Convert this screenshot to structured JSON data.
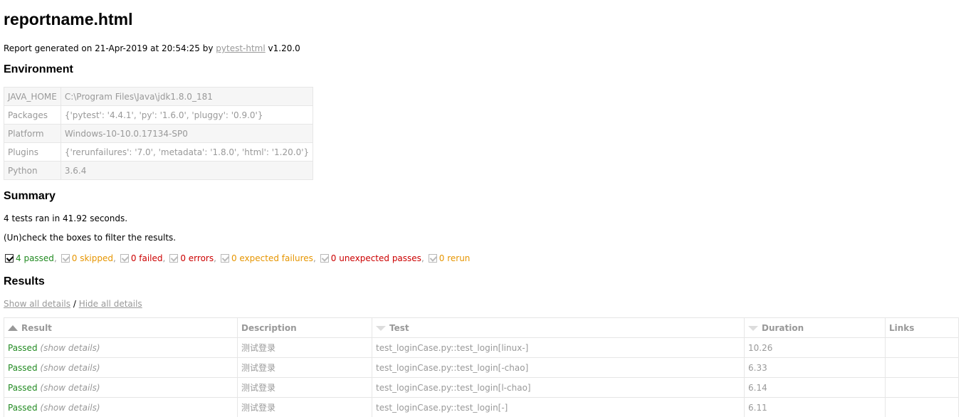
{
  "report": {
    "title": "reportname.html",
    "generated_prefix": "Report generated on 21-Apr-2019 at 20:54:25 by ",
    "generated_link": "pytest-html",
    "generated_suffix": " v1.20.0"
  },
  "environment": {
    "heading": "Environment",
    "rows": [
      {
        "key": "JAVA_HOME",
        "value": "C:\\Program Files\\Java\\jdk1.8.0_181"
      },
      {
        "key": "Packages",
        "value": "{'pytest': '4.4.1', 'py': '1.6.0', 'pluggy': '0.9.0'}"
      },
      {
        "key": "Platform",
        "value": "Windows-10-10.0.17134-SP0"
      },
      {
        "key": "Plugins",
        "value": "{'rerunfailures': '7.0', 'metadata': '1.8.0', 'html': '1.20.0'}"
      },
      {
        "key": "Python",
        "value": "3.6.4"
      }
    ]
  },
  "summary": {
    "heading": "Summary",
    "tests_ran": "4 tests ran in 41.92 seconds.",
    "filter_hint": "(Un)check the boxes to filter the results.",
    "filters": [
      {
        "label": "4 passed",
        "color": "#228b22"
      },
      {
        "label": "0 skipped",
        "color": "#e69500"
      },
      {
        "label": "0 failed",
        "color": "#cc0000"
      },
      {
        "label": "0 errors",
        "color": "#cc0000"
      },
      {
        "label": "0 expected failures",
        "color": "#e69500"
      },
      {
        "label": "0 unexpected passes",
        "color": "#cc0000"
      },
      {
        "label": "0 rerun",
        "color": "#e69500"
      }
    ]
  },
  "results": {
    "heading": "Results",
    "show_all": "Show all details",
    "separator": " / ",
    "hide_all": "Hide all details",
    "columns": [
      "Result",
      "Description",
      "Test",
      "Duration",
      "Links"
    ],
    "rows": [
      {
        "result": "Passed",
        "details": "(show details)",
        "description": "测试登录",
        "test": "test_loginCase.py::test_login[linux-]",
        "duration": "10.26",
        "links": ""
      },
      {
        "result": "Passed",
        "details": "(show details)",
        "description": "测试登录",
        "test": "test_loginCase.py::test_login[-chao]",
        "duration": "6.33",
        "links": ""
      },
      {
        "result": "Passed",
        "details": "(show details)",
        "description": "测试登录",
        "test": "test_loginCase.py::test_login[l-chao]",
        "duration": "6.14",
        "links": ""
      },
      {
        "result": "Passed",
        "details": "(show details)",
        "description": "测试登录",
        "test": "test_loginCase.py::test_login[-]",
        "duration": "6.11",
        "links": ""
      }
    ]
  }
}
